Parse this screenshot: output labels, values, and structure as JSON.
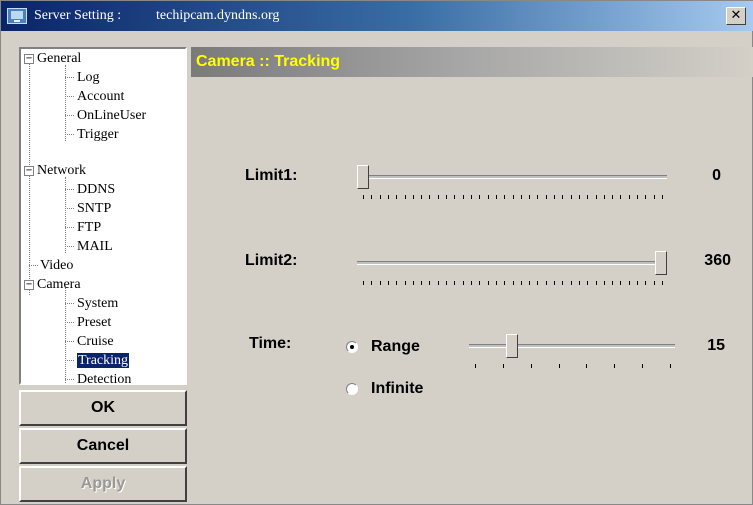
{
  "window": {
    "title_label": "Server Setting :",
    "title_host": "techipcam.dyndns.org",
    "close_glyph": "✕"
  },
  "tree": {
    "general": {
      "label": "General",
      "expander": "−",
      "children": [
        "Log",
        "Account",
        "OnLineUser",
        "Trigger"
      ]
    },
    "network": {
      "label": "Network",
      "expander": "−",
      "children": [
        "DDNS",
        "SNTP",
        "FTP",
        "MAIL"
      ]
    },
    "video": {
      "label": "Video"
    },
    "camera": {
      "label": "Camera",
      "expander": "−",
      "children": [
        "System",
        "Preset",
        "Cruise",
        "Tracking",
        "Detection"
      ]
    },
    "selected": "Tracking"
  },
  "buttons": {
    "ok": "OK",
    "cancel": "Cancel",
    "apply": "Apply"
  },
  "header": {
    "title": "Camera :: Tracking"
  },
  "settings": {
    "limit1": {
      "label": "Limit1:",
      "value": "0",
      "min": 0,
      "max": 360
    },
    "limit2": {
      "label": "Limit2:",
      "value": "360",
      "min": 0,
      "max": 360
    },
    "time": {
      "label": "Time:",
      "range_label": "Range",
      "infinite_label": "Infinite",
      "selected": "Range",
      "value": "15",
      "level_fraction": 0.22
    }
  },
  "colors": {
    "title_gradient_start": "#0a246a",
    "header_text": "#ffff00",
    "selection": "#0a246a",
    "face": "#d4d0c8"
  }
}
